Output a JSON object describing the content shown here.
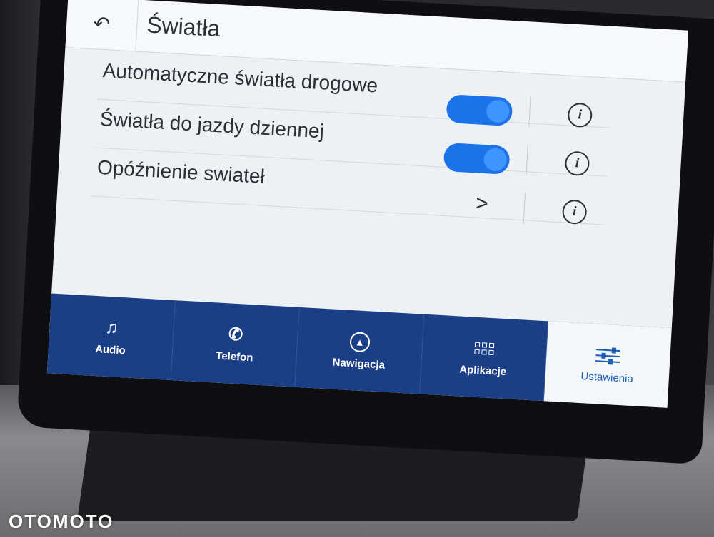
{
  "header": {
    "back_icon": "back-arrow-icon",
    "title": "Światła"
  },
  "settings": [
    {
      "label": "Automatyczne światła drogowe",
      "control": "toggle",
      "state": "on"
    },
    {
      "label": "Światła do jazdy dziennej",
      "control": "toggle",
      "state": "on"
    },
    {
      "label": "Opóźnienie swiateł",
      "control": "chevron"
    }
  ],
  "info_icon": "i",
  "chevron_glyph": ">",
  "nav": {
    "items": [
      {
        "label": "Audio",
        "icon": "music-note-icon"
      },
      {
        "label": "Telefon",
        "icon": "phone-icon"
      },
      {
        "label": "Nawigacja",
        "icon": "navigation-arrow-icon"
      },
      {
        "label": "Aplikacje",
        "icon": "apps-grid-icon"
      },
      {
        "label": "Ustawienia",
        "icon": "settings-sliders-icon",
        "active": true
      }
    ]
  },
  "watermark": "OTOMOTO",
  "colors": {
    "accent": "#1a73e8",
    "nav_bar": "#1b3f87",
    "active_tab_text": "#1a5fb4",
    "screen_bg": "#eef1f4"
  }
}
